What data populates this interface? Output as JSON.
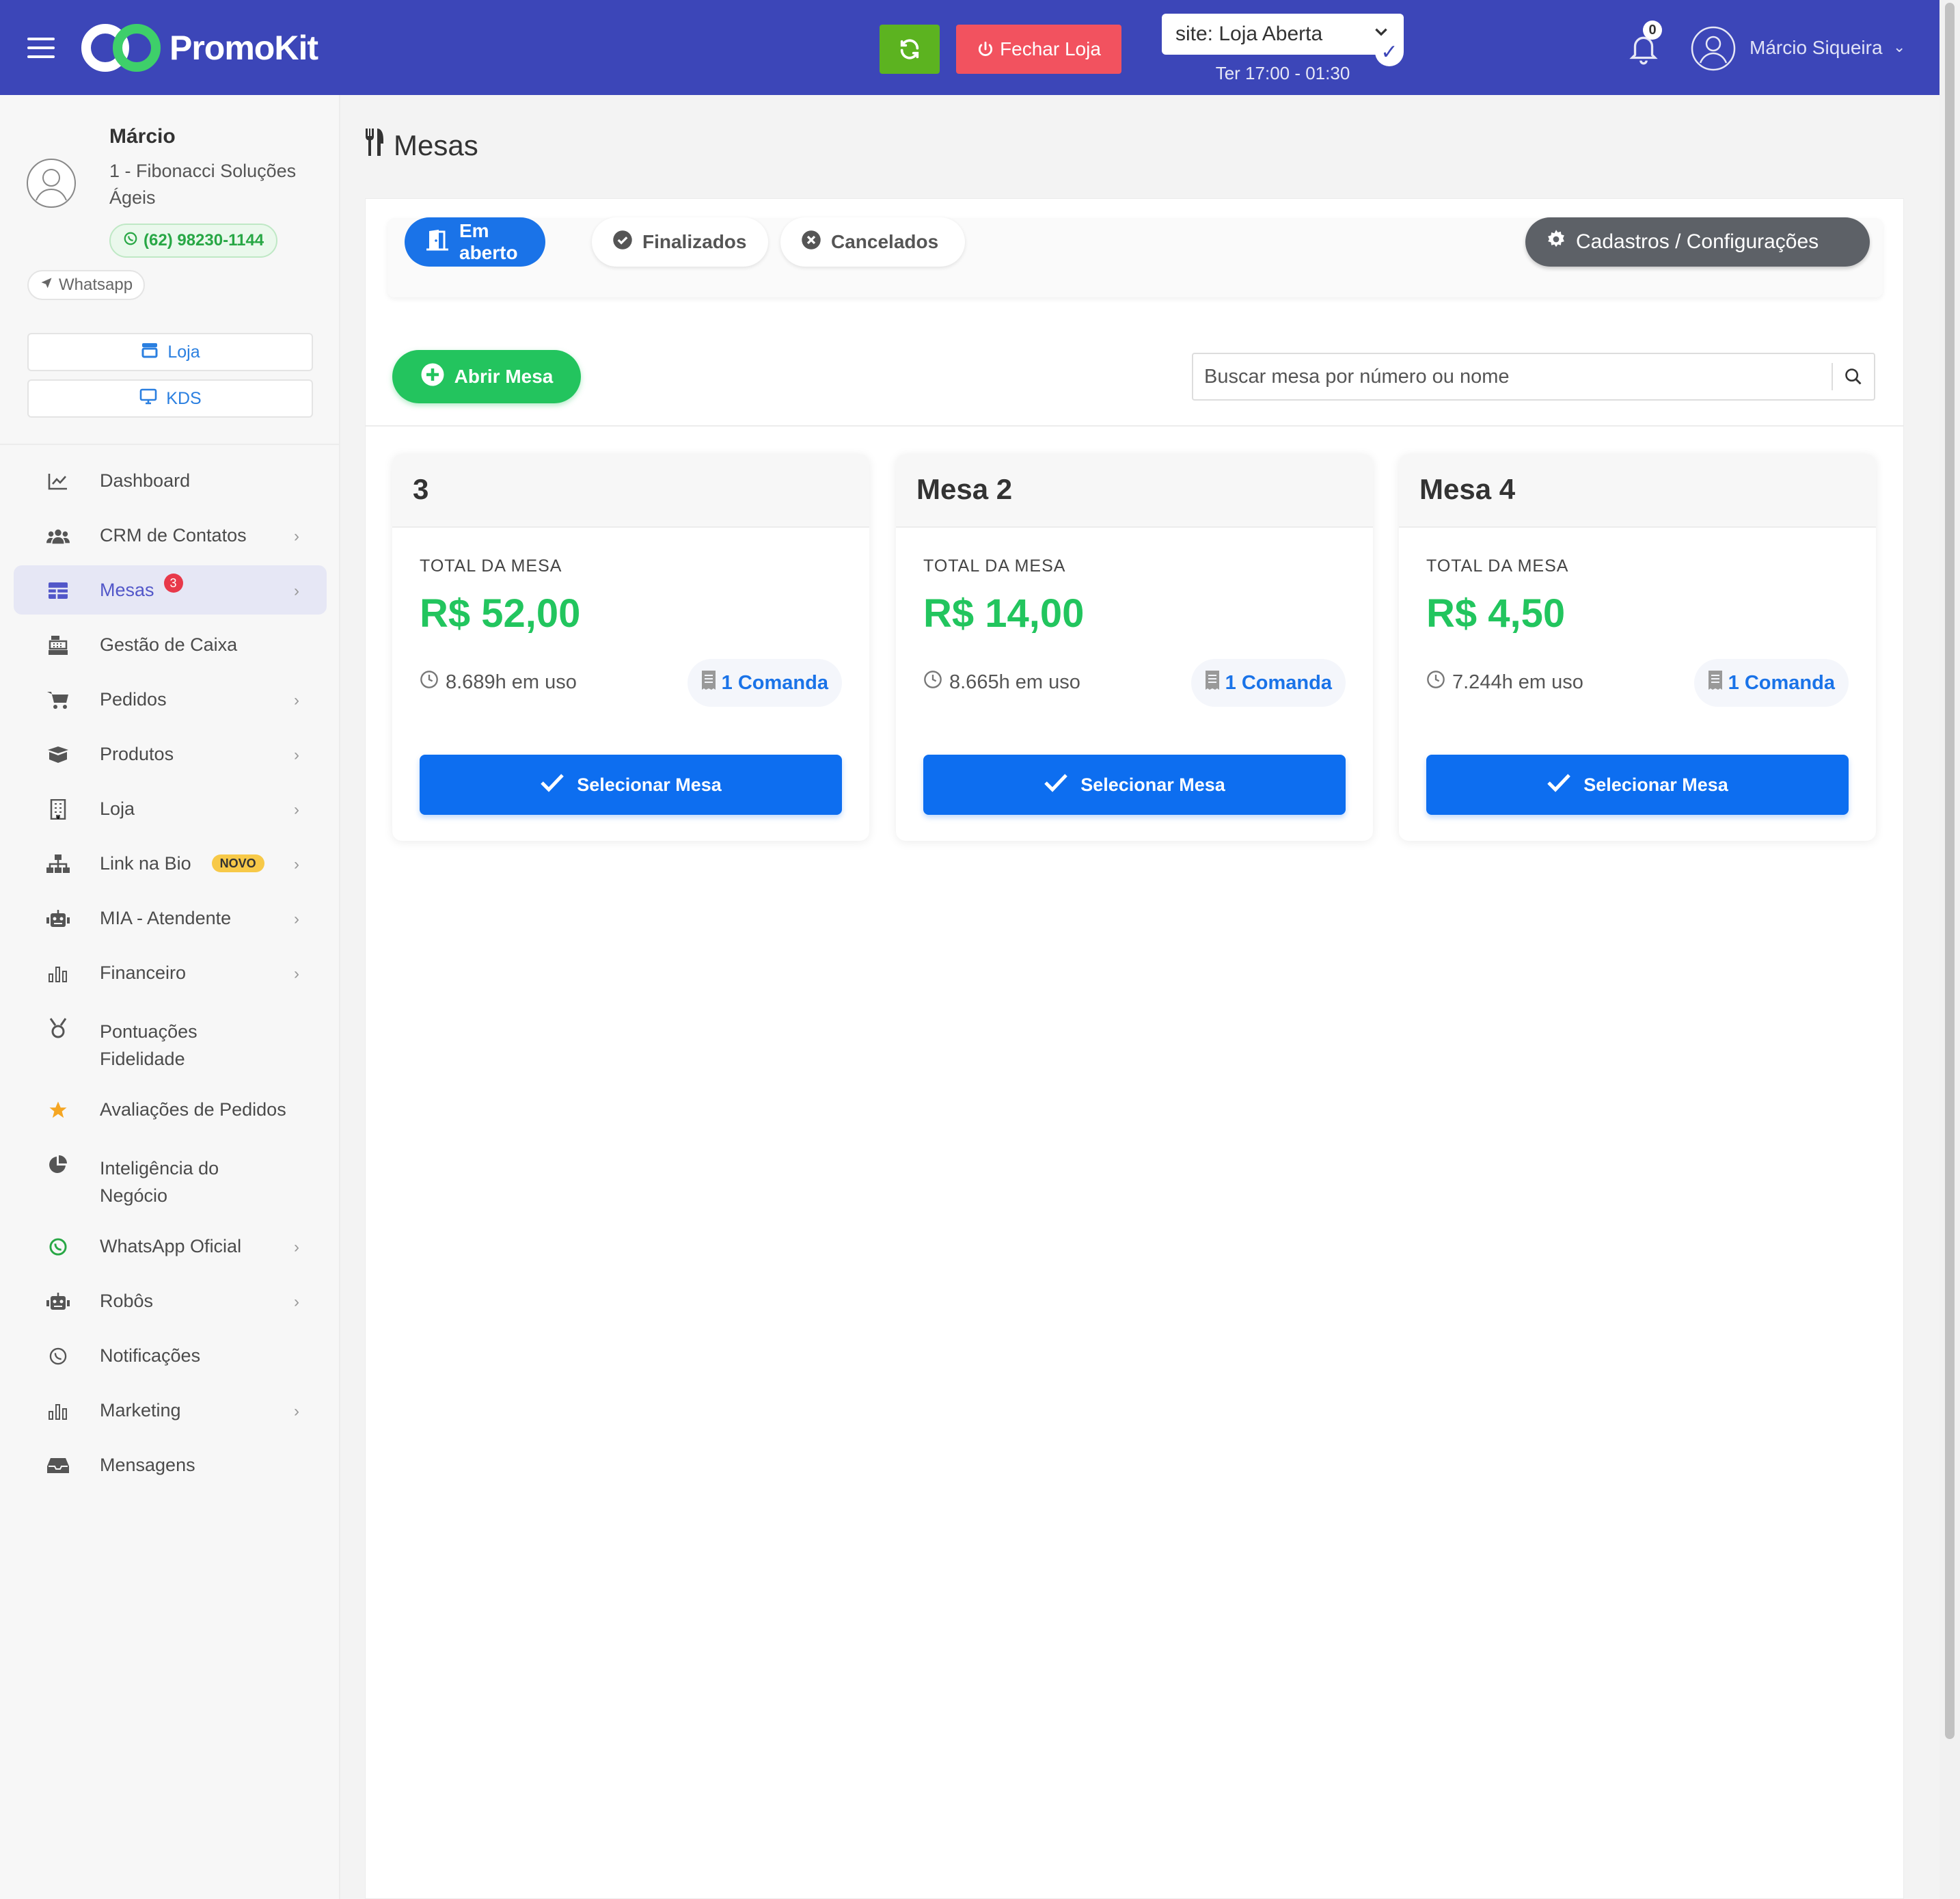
{
  "header": {
    "brand": "PromoKit",
    "close_store_label": "Fechar Loja",
    "site_status": "site: Loja Aberta",
    "hours": "Ter 17:00 - 01:30",
    "notifications_count": "0",
    "user_name": "Márcio Siqueira"
  },
  "sidebar": {
    "profile": {
      "name": "Márcio",
      "company": "1 - Fibonacci Soluções Ágeis",
      "phone": "(62) 98230-1144",
      "whatsapp_label": "Whatsapp"
    },
    "loja_label": "Loja",
    "kds_label": "KDS",
    "items": [
      {
        "label": "Dashboard",
        "icon": "chart-line-icon"
      },
      {
        "label": "CRM de Contatos",
        "icon": "users-icon"
      },
      {
        "label": "Mesas",
        "icon": "table-icon",
        "badge": "3"
      },
      {
        "label": "Gestão de Caixa",
        "icon": "cash-register-icon"
      },
      {
        "label": "Pedidos",
        "icon": "cart-icon"
      },
      {
        "label": "Produtos",
        "icon": "box-icon"
      },
      {
        "label": "Loja",
        "icon": "building-icon"
      },
      {
        "label": "Link na Bio",
        "icon": "sitemap-icon",
        "tag": "NOVO"
      },
      {
        "label": "MIA - Atendente",
        "icon": "robot-icon"
      },
      {
        "label": "Financeiro",
        "icon": "bar-chart-icon"
      },
      {
        "label": "Pontuações Fidelidade",
        "icon": "medal-icon"
      },
      {
        "label": "Avaliações de Pedidos",
        "icon": "star-icon"
      },
      {
        "label": "Inteligência do Negócio",
        "icon": "pie-chart-icon"
      },
      {
        "label": "WhatsApp Oficial",
        "icon": "whatsapp-icon"
      },
      {
        "label": "Robôs",
        "icon": "robot-icon"
      },
      {
        "label": "Notificações",
        "icon": "whatsapp-icon"
      },
      {
        "label": "Marketing",
        "icon": "bar-chart-icon"
      },
      {
        "label": "Mensagens",
        "icon": "inbox-icon"
      }
    ]
  },
  "main": {
    "title": "Mesas",
    "tabs": {
      "open": "Em aberto",
      "finished": "Finalizados",
      "cancelled": "Cancelados"
    },
    "config_label": "Cadastros / Configurações",
    "open_table_label": "Abrir Mesa",
    "search_placeholder": "Buscar mesa por número ou nome",
    "total_label": "TOTAL DA MESA",
    "select_label": "Selecionar Mesa",
    "tables": [
      {
        "name": "3",
        "total": "R$ 52,00",
        "time": "8.689h em uso",
        "orders": "1 Comanda"
      },
      {
        "name": "Mesa 2",
        "total": "R$ 14,00",
        "time": "8.665h em uso",
        "orders": "1 Comanda"
      },
      {
        "name": "Mesa 4",
        "total": "R$ 4,50",
        "time": "7.244h em uso",
        "orders": "1 Comanda"
      }
    ]
  },
  "colors": {
    "header_bg": "#3c46b8",
    "primary": "#1a73e8",
    "success": "#22c55e",
    "danger": "#f2525f"
  }
}
